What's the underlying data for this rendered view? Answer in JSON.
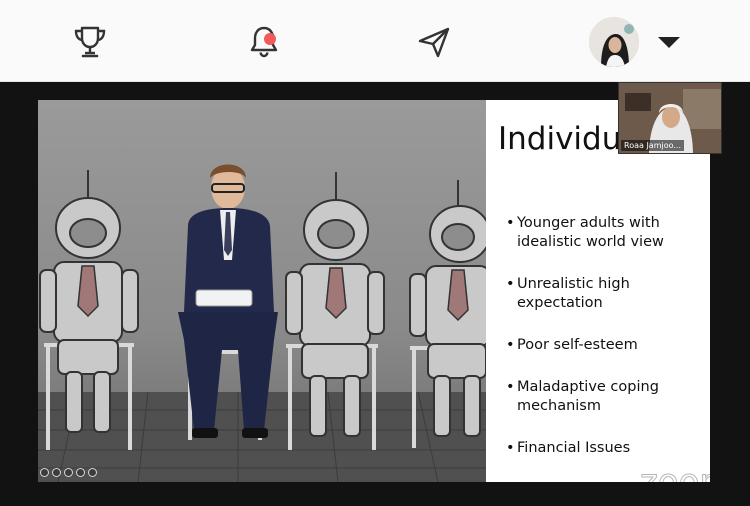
{
  "nav": {
    "trophy_icon": "trophy-icon",
    "bell_icon": "bell-icon",
    "notification_dot_color": "#f05a5a",
    "send_icon": "send-icon",
    "profile_caret_icon": "caret-down-icon"
  },
  "meeting": {
    "slide": {
      "title": "Individual factors:",
      "bullets": [
        "Younger adults with idealistic world view",
        "Unrealistic high expectation",
        "Poor self-esteem",
        "Maladaptive coping mechanism",
        "Financial Issues"
      ]
    },
    "participant_name": "Roaa Jamjoo...",
    "watermark": "zoom"
  }
}
